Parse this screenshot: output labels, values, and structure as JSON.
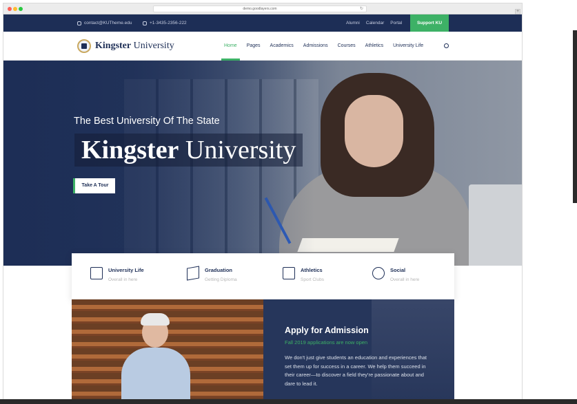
{
  "browser": {
    "url": "demo.goodlayers.com",
    "reload_icon": "↻",
    "new_tab_icon": "+"
  },
  "topbar": {
    "email": "contact@KUTheme.edu",
    "phone": "+1-3435-2356-222",
    "links": [
      "Alumni",
      "Calendar",
      "Portal"
    ],
    "support_button": "Support KU",
    "accent_color": "#3db166",
    "background_color": "#1d2e56"
  },
  "nav": {
    "logo_bold": "Kingster",
    "logo_regular": "University",
    "items": [
      {
        "label": "Home",
        "active": true
      },
      {
        "label": "Pages",
        "active": false
      },
      {
        "label": "Academics",
        "active": false
      },
      {
        "label": "Admissions",
        "active": false
      },
      {
        "label": "Courses",
        "active": false
      },
      {
        "label": "Athletics",
        "active": false
      },
      {
        "label": "University Life",
        "active": false
      }
    ]
  },
  "hero": {
    "subtitle": "The Best University Of The State",
    "title_bold": "Kingster",
    "title_regular": "University",
    "cta": "Take A Tour"
  },
  "features": [
    {
      "title": "University Life",
      "subtitle": "Overall in here",
      "icon": "building-icon"
    },
    {
      "title": "Graduation",
      "subtitle": "Getting Diploma",
      "icon": "graduation-cap-icon"
    },
    {
      "title": "Athletics",
      "subtitle": "Sport Clubs",
      "icon": "stadium-icon"
    },
    {
      "title": "Social",
      "subtitle": "Overall in here",
      "icon": "network-icon"
    }
  ],
  "admission": {
    "title": "Apply for Admission",
    "subtitle": "Fall 2019 applications are now open",
    "text": "We don't just give students an education and experiences that set them up for success in a career. We help them succeed in their career—to discover a field they're passionate about and dare to lead it."
  }
}
